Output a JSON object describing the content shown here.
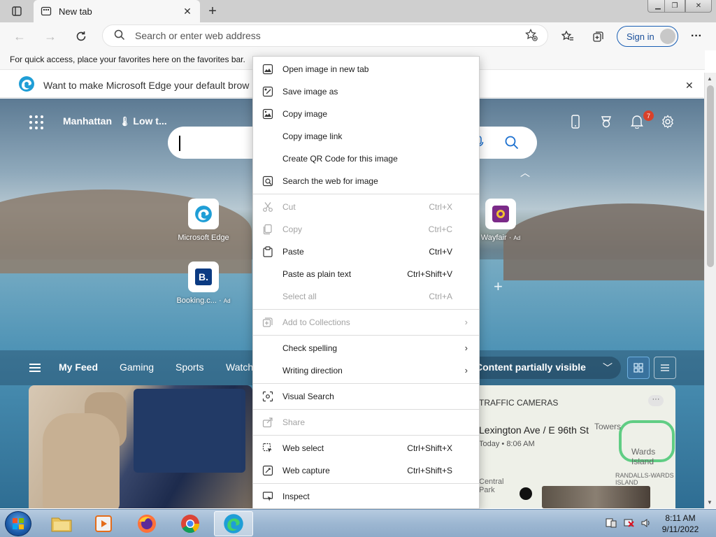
{
  "browser": {
    "tab_title": "New tab",
    "address_placeholder": "Search or enter web address",
    "sign_in_label": "Sign in",
    "favorites_bar_text": "For quick access, place your favorites here on the favorites bar.",
    "banner_text": "Want to make Microsoft Edge your default brow"
  },
  "newtab": {
    "location": "Manhattan",
    "weather": "Low t...",
    "notification_count": "7",
    "tiles": [
      {
        "label": "Microsoft Edge",
        "ad": ""
      },
      {
        "label": "Booking.c...",
        "ad": "Ad"
      },
      {
        "label": "Wayfair",
        "ad": "Ad"
      }
    ],
    "feed_tabs": [
      "My Feed",
      "Gaming",
      "Sports",
      "Watch"
    ],
    "visibility_label": "Content partially visible",
    "map_card": {
      "title": "TRAFFIC CAMERAS",
      "road": "Lexington Ave / E 96th St",
      "time": "Today • 8:06 AM",
      "labels": [
        "Towers",
        "Wards Island",
        "RANDALLS-WARDS ISLAND",
        "Central Park"
      ]
    }
  },
  "context_menu": {
    "groups": [
      [
        {
          "label": "Open image in new tab",
          "icon": "open-image-tab-icon",
          "shortcut": "",
          "disabled": false,
          "submenu": false
        },
        {
          "label": "Save image as",
          "icon": "save-image-icon",
          "shortcut": "",
          "disabled": false,
          "submenu": false
        },
        {
          "label": "Copy image",
          "icon": "copy-image-icon",
          "shortcut": "",
          "disabled": false,
          "submenu": false
        },
        {
          "label": "Copy image link",
          "icon": "",
          "shortcut": "",
          "disabled": false,
          "submenu": false
        },
        {
          "label": "Create QR Code for this image",
          "icon": "",
          "shortcut": "",
          "disabled": false,
          "submenu": false
        },
        {
          "label": "Search the web for image",
          "icon": "search-image-icon",
          "shortcut": "",
          "disabled": false,
          "submenu": false
        }
      ],
      [
        {
          "label": "Cut",
          "icon": "scissors-icon",
          "shortcut": "Ctrl+X",
          "disabled": true,
          "submenu": false
        },
        {
          "label": "Copy",
          "icon": "copy-icon",
          "shortcut": "Ctrl+C",
          "disabled": true,
          "submenu": false
        },
        {
          "label": "Paste",
          "icon": "paste-icon",
          "shortcut": "Ctrl+V",
          "disabled": false,
          "submenu": false
        },
        {
          "label": "Paste as plain text",
          "icon": "",
          "shortcut": "Ctrl+Shift+V",
          "disabled": false,
          "submenu": false
        },
        {
          "label": "Select all",
          "icon": "",
          "shortcut": "Ctrl+A",
          "disabled": true,
          "submenu": false
        }
      ],
      [
        {
          "label": "Add to Collections",
          "icon": "collections-icon",
          "shortcut": "",
          "disabled": true,
          "submenu": true
        }
      ],
      [
        {
          "label": "Check spelling",
          "icon": "",
          "shortcut": "",
          "disabled": false,
          "submenu": true
        },
        {
          "label": "Writing direction",
          "icon": "",
          "shortcut": "",
          "disabled": false,
          "submenu": true
        }
      ],
      [
        {
          "label": "Visual Search",
          "icon": "visual-search-icon",
          "shortcut": "",
          "disabled": false,
          "submenu": false
        }
      ],
      [
        {
          "label": "Share",
          "icon": "share-icon",
          "shortcut": "",
          "disabled": true,
          "submenu": false
        }
      ],
      [
        {
          "label": "Web select",
          "icon": "web-select-icon",
          "shortcut": "Ctrl+Shift+X",
          "disabled": false,
          "submenu": false
        },
        {
          "label": "Web capture",
          "icon": "web-capture-icon",
          "shortcut": "Ctrl+Shift+S",
          "disabled": false,
          "submenu": false
        }
      ],
      [
        {
          "label": "Inspect",
          "icon": "inspect-icon",
          "shortcut": "",
          "disabled": false,
          "submenu": false
        }
      ]
    ]
  },
  "taskbar": {
    "time": "8:11 AM",
    "date": "9/11/2022"
  },
  "colors": {
    "accent": "#1a5fb4",
    "badge": "#d9412a"
  }
}
